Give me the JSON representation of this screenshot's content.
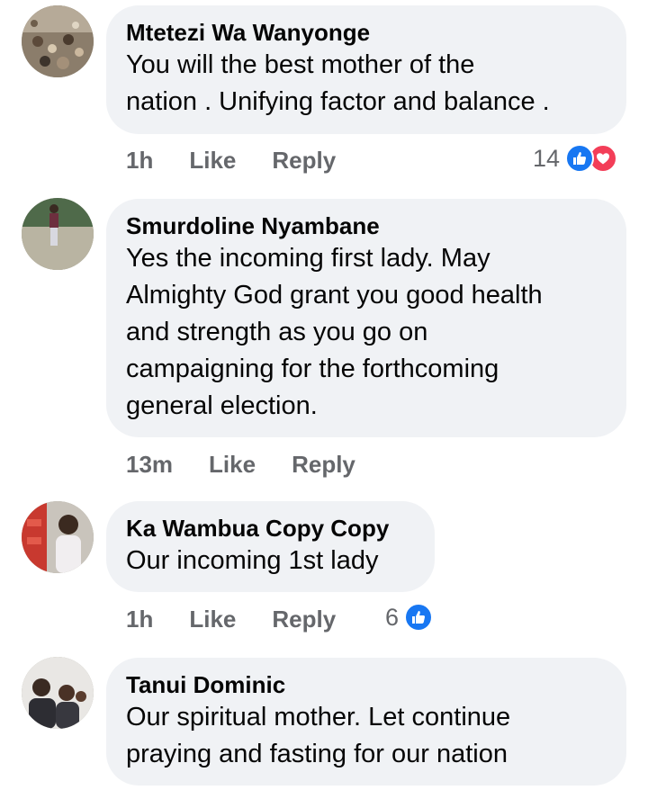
{
  "colors": {
    "bubble": "#f0f2f5",
    "meta": "#65676b",
    "like_blue": "#1877f2",
    "love_red": "#f33e58"
  },
  "comments": [
    {
      "author": "Mtetezi Wa Wanyonge",
      "text": "You will the best mother of the\nnation . Unifying factor and balance .",
      "time": "1h",
      "like_label": "Like",
      "reply_label": "Reply",
      "reaction_count": "14",
      "reactions": [
        "like-icon",
        "love-icon"
      ]
    },
    {
      "author": "Smurdoline Nyambane",
      "text": "Yes the incoming first lady. May\nAlmighty God grant you good health\nand strength as you go on\ncampaigning for the forthcoming\ngeneral election.",
      "time": "13m",
      "like_label": "Like",
      "reply_label": "Reply"
    },
    {
      "author": "Ka Wambua Copy Copy",
      "text": "Our incoming 1st lady",
      "time": "1h",
      "like_label": "Like",
      "reply_label": "Reply",
      "reaction_count": "6",
      "reactions": [
        "like-icon"
      ]
    },
    {
      "author": "Tanui Dominic",
      "text": "Our spiritual mother. Let continue\npraying and fasting for our nation"
    }
  ]
}
